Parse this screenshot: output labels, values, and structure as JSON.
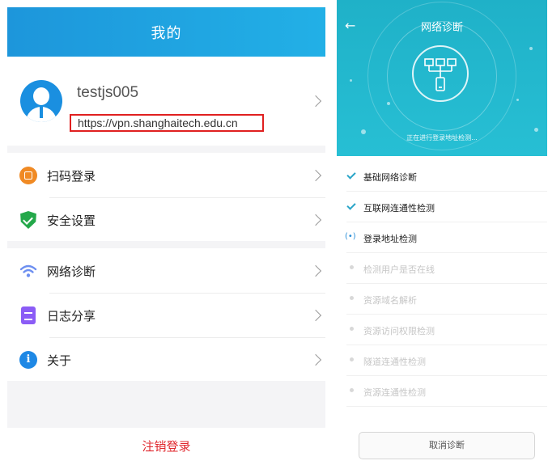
{
  "left": {
    "header": {
      "title": "我的"
    },
    "profile": {
      "username": "testjs005",
      "url": "https://vpn.shanghaitech.edu.cn"
    },
    "menu_group_1": [
      {
        "label": "扫码登录",
        "icon": "qr-scan-icon",
        "color": "#f08a24"
      },
      {
        "label": "安全设置",
        "icon": "shield-icon",
        "color": "#24a84a"
      }
    ],
    "menu_group_2": [
      {
        "label": "网络诊断",
        "icon": "wifi-icon",
        "color": "#1e88e5"
      },
      {
        "label": "日志分享",
        "icon": "log-clipboard-icon",
        "color": "#8b5cf6"
      },
      {
        "label": "关于",
        "icon": "info-icon",
        "color": "#1e88e5"
      }
    ],
    "logout_label": "注销登录"
  },
  "right": {
    "header": {
      "back_icon": "back-arrow-icon",
      "title": "网络诊断"
    },
    "status_text": "正在进行登录地址检测...",
    "steps": [
      {
        "label": "基础网络诊断",
        "state": "done"
      },
      {
        "label": "互联网连通性检测",
        "state": "done"
      },
      {
        "label": "登录地址检测",
        "state": "active"
      },
      {
        "label": "检测用户是否在线",
        "state": "pending"
      },
      {
        "label": "资源域名解析",
        "state": "pending"
      },
      {
        "label": "资源访问权限检测",
        "state": "pending"
      },
      {
        "label": "隧道连通性检测",
        "state": "pending"
      },
      {
        "label": "资源连通性检测",
        "state": "pending"
      }
    ],
    "cancel_label": "取消诊断"
  }
}
